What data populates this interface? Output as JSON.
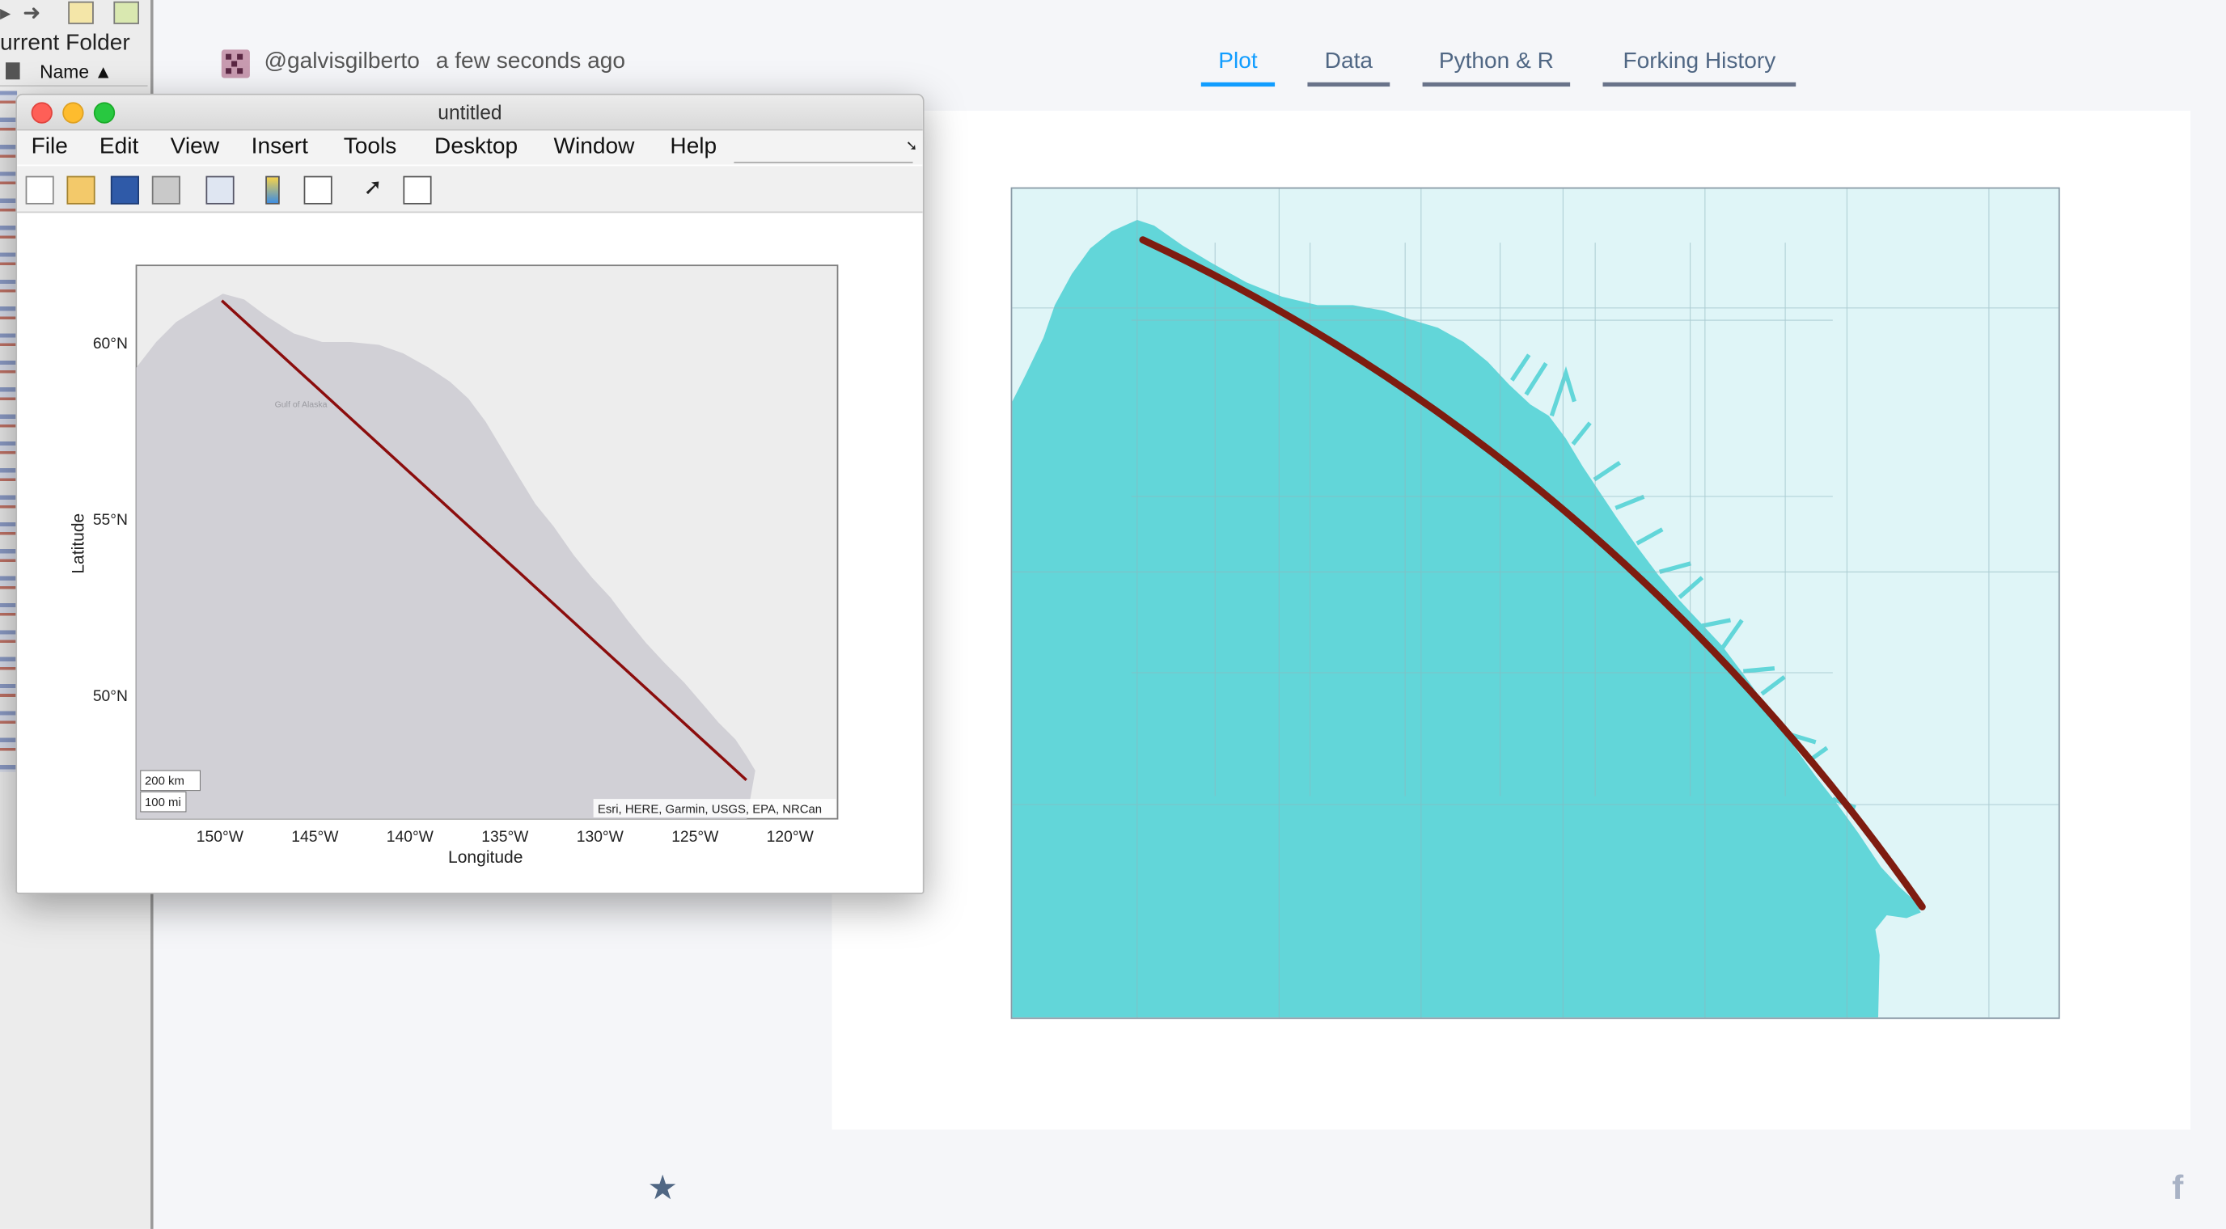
{
  "matlab_desktop": {
    "current_folder_label": "urrent Folder",
    "name_column": "Name ▲"
  },
  "plotly": {
    "user": "@galvisgilberto",
    "time": "a few seconds ago",
    "tabs": [
      {
        "label": "Plot",
        "active": true
      },
      {
        "label": "Data",
        "active": false
      },
      {
        "label": "Python & R",
        "active": false
      },
      {
        "label": "Forking History",
        "active": false
      }
    ],
    "colors": {
      "land": "#dff5f7",
      "ocean": "#62d6d9",
      "route": "#7e1c10",
      "accent": "#119dff"
    },
    "icons": [
      "star-icon",
      "facebook-icon"
    ]
  },
  "figure_window": {
    "title": "untitled",
    "menu": [
      "File",
      "Edit",
      "View",
      "Insert",
      "Tools",
      "Desktop",
      "Window",
      "Help"
    ],
    "toolbar": [
      "new-figure-icon",
      "open-file-icon",
      "save-icon",
      "print-icon",
      "link-icon",
      "colorbar-icon",
      "legend-icon",
      "pointer-icon",
      "property-editor-icon"
    ]
  },
  "chart_data": {
    "type": "line",
    "xlabel": "Longitude",
    "ylabel": "Latitude",
    "x_ticks": [
      "150°W",
      "145°W",
      "140°W",
      "135°W",
      "130°W",
      "125°W",
      "120°W"
    ],
    "y_ticks": [
      "60°N",
      "55°N",
      "50°N"
    ],
    "series": [
      {
        "x": [
          -149.9,
          -122.3
        ],
        "y": [
          61.2,
          47.6
        ]
      }
    ],
    "basemap_label": "Gulf of Alaska",
    "attribution": "Esri, HERE, Garmin, USGS, EPA, NRCan",
    "scalebar": [
      "200 km",
      "100 mi"
    ],
    "grid": true
  }
}
